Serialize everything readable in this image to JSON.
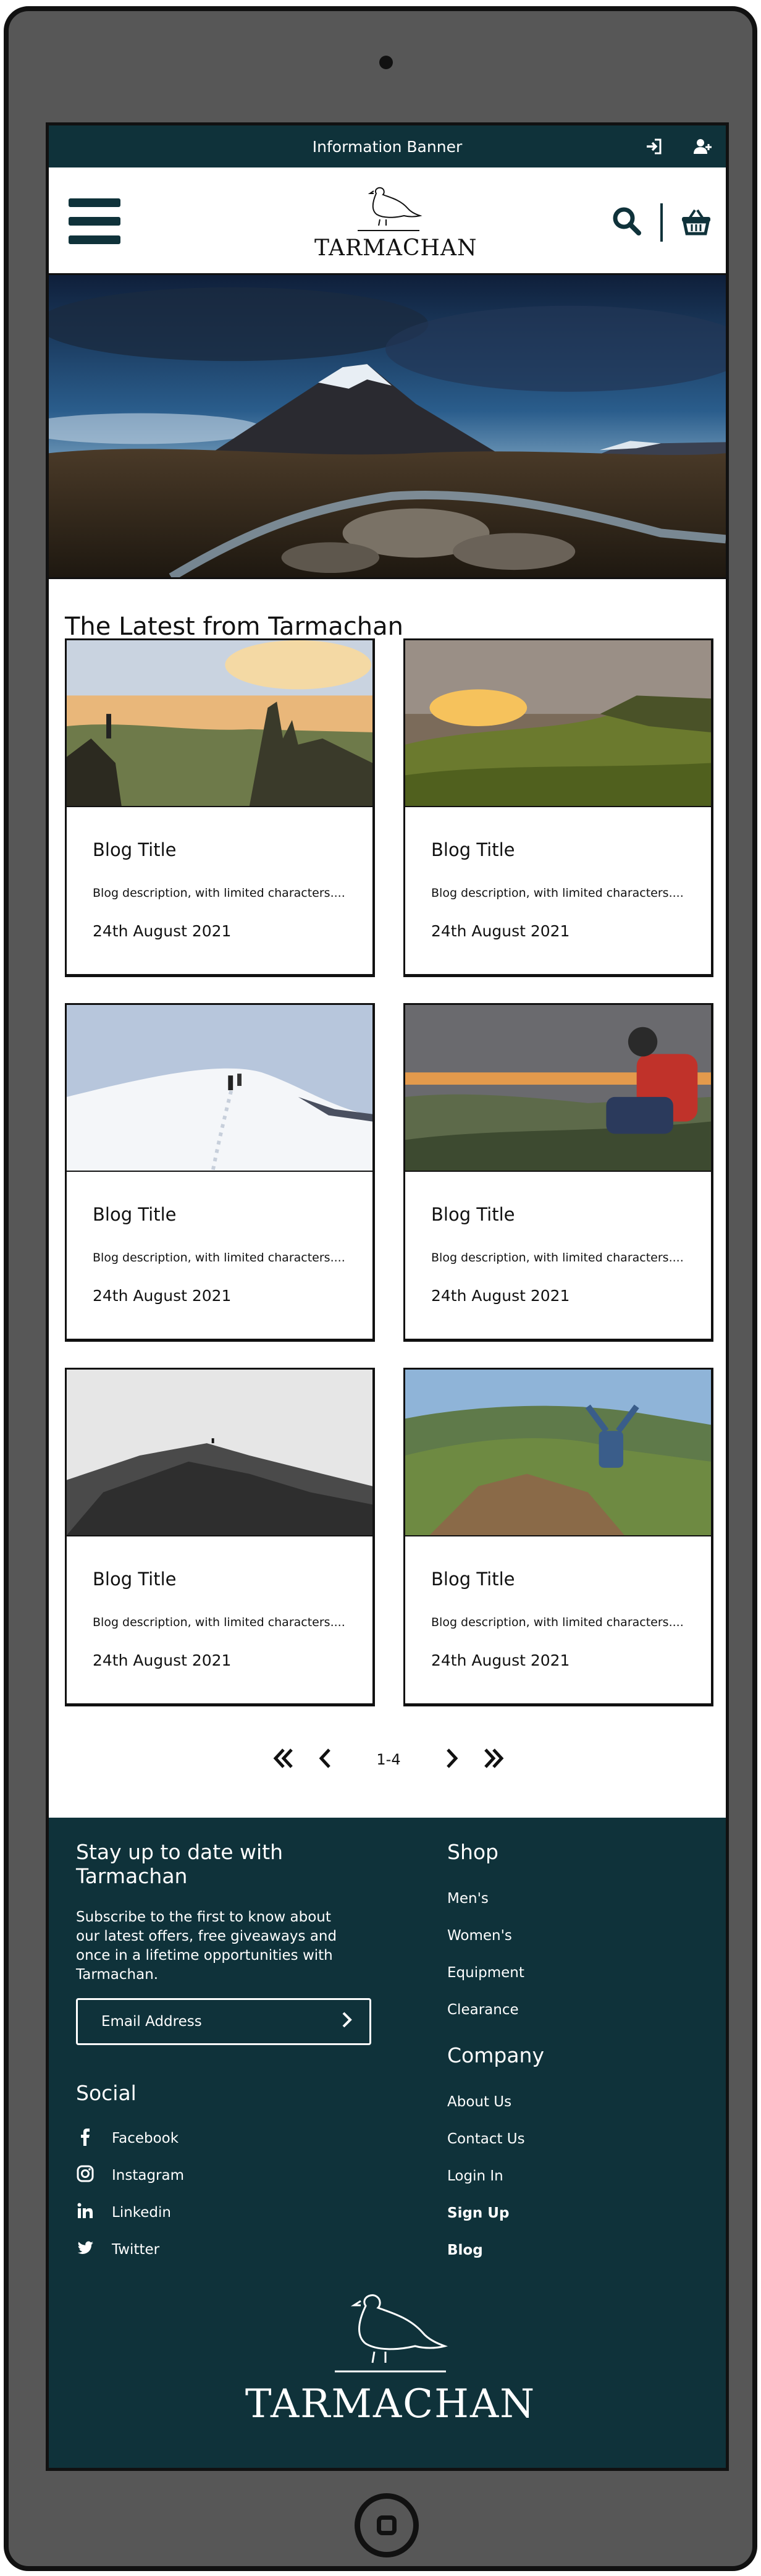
{
  "banner": {
    "text": "Information Banner"
  },
  "header": {
    "logo_text": "TARMACHAN"
  },
  "latest": {
    "title": "The Latest from Tarmachan",
    "cards": [
      {
        "title": "Blog Title",
        "description": "Blog description, with limited characters....",
        "date": "24th August 2021"
      },
      {
        "title": "Blog Title",
        "description": "Blog description, with limited characters....",
        "date": "24th August 2021"
      },
      {
        "title": "Blog Title",
        "description": "Blog description, with limited characters....",
        "date": "24th August 2021"
      },
      {
        "title": "Blog Title",
        "description": "Blog description, with limited characters....",
        "date": "24th August 2021"
      },
      {
        "title": "Blog Title",
        "description": "Blog description, with limited characters....",
        "date": "24th August 2021"
      },
      {
        "title": "Blog Title",
        "description": "Blog description, with limited characters....",
        "date": "24th August 2021"
      }
    ]
  },
  "pagination": {
    "range": "1-4"
  },
  "footer": {
    "newsletter_title": "Stay up to date with Tarmachan",
    "newsletter_text": "Subscribe to the first to know about our latest offers, free giveaways and once in a lifetime opportunities with Tarmachan.",
    "email_placeholder": "Email Address",
    "social_title": "Social",
    "social": [
      "Facebook",
      "Instagram",
      "Linkedin",
      "Twitter"
    ],
    "shop_title": "Shop",
    "shop_links": [
      "Men's",
      "Women's",
      "Equipment",
      "Clearance"
    ],
    "company_title": "Company",
    "company_links": [
      "About Us",
      "Contact Us",
      "Login In",
      "Sign Up",
      "Blog"
    ],
    "logo_text": "TARMACHAN"
  },
  "colors": {
    "brand_dark": "#0f323a",
    "frame": "#575757"
  },
  "icons": [
    "login-icon",
    "add-user-icon",
    "menu-icon",
    "search-icon",
    "basket-icon",
    "facebook-icon",
    "instagram-icon",
    "linkedin-icon",
    "twitter-icon"
  ]
}
